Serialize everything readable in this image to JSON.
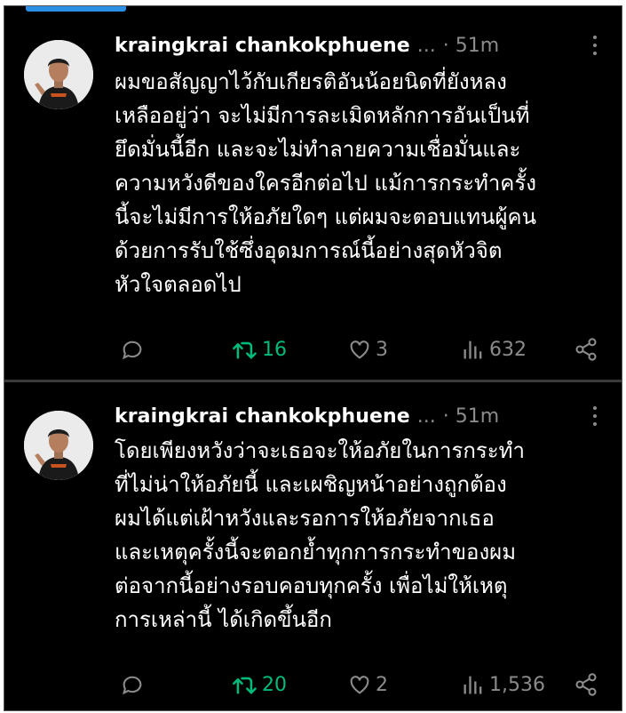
{
  "posts": [
    {
      "author": "kraingkrai chankokphuene",
      "ellipsis": "...",
      "time": "· 51m",
      "text": "ผมขอสัญญาไว้กับเกียรติอันน้อยนิดที่ยังหลง\nเหลืออยู่ว่า จะไม่มีการละเมิดหลักการอันเป็นที่\nยึดมั่นนี้อีก และจะไม่ทำลายความเชื่อมั่นและ\nความหวังดีของใครอีกต่อไป แม้การกระทำครั้ง\nนี้จะไม่มีการให้อภัยใดๆ แต่ผมจะตอบแทนผู้คน\nด้วยการรับใช้ซึ่งอุดมการณ์นี้อย่างสุดหัวจิต\nหัวใจตลอดไป",
      "reposts": "16",
      "likes": "3",
      "views": "632"
    },
    {
      "author": "kraingkrai chankokphuene",
      "ellipsis": "...",
      "time": "· 51m",
      "text": "โดยเพียงหวังว่าจะเธอจะให้อภัยในการกระทำ\nที่ไม่น่าให้อภัยนี้ และเผชิญหน้าอย่างถูกต้อง\nผมได้แต่เฝ้าหวังและรอการให้อภัยจากเธอ\n และเหตุครั้งนี้จะตอกย้ำทุกการกระทำของผม\nต่อจากนี้อย่างรอบคอบทุกครั้ง เพื่อไม่ให้เหตุ\nการเหล่านี้ ได้เกิดขึ้นอีก",
      "reposts": "20",
      "likes": "2",
      "views": "1,536"
    }
  ],
  "colors": {
    "background": "#000000",
    "text": "#ffffff",
    "muted": "#8b8b8b",
    "repost_active": "#00ba7c",
    "accent": "#2b8fe6"
  },
  "icons": [
    "reply-icon",
    "repost-icon",
    "heart-icon",
    "views-icon",
    "share-icon",
    "more-icon"
  ]
}
